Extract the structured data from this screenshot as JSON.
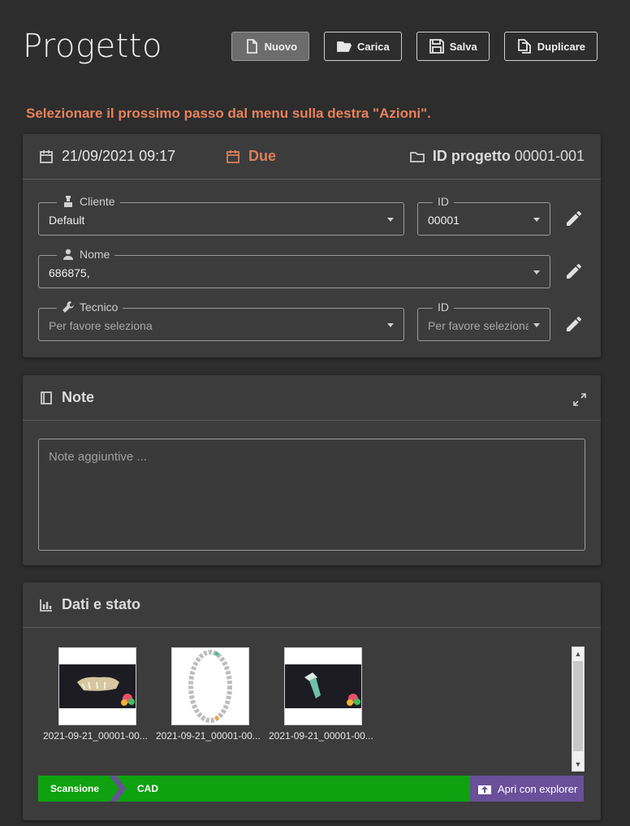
{
  "page": {
    "title": "Progetto"
  },
  "toolbar": {
    "new": "Nuovo",
    "load": "Carica",
    "save": "Salva",
    "duplicate": "Duplicare"
  },
  "hint": "Selezionare il prossimo passo dal menu sulla destra \"Azioni\".",
  "project": {
    "date": "21/09/2021 09:17",
    "due_label": "Due",
    "id_label": "ID progetto",
    "id_value": "00001-001",
    "cliente": {
      "label": "Cliente",
      "value": "Default"
    },
    "cliente_id": {
      "label": "ID",
      "value": "00001"
    },
    "nome": {
      "label": "Nome",
      "value": "686875,"
    },
    "tecnico": {
      "label": "Tecnico",
      "placeholder": "Per favore seleziona"
    },
    "tecnico_id": {
      "label": "ID",
      "placeholder": "Per favore seleziona"
    }
  },
  "notes": {
    "title": "Note",
    "placeholder": "Note aggiuntive ..."
  },
  "data": {
    "title": "Dati e stato",
    "files": [
      {
        "label": "2021-09-21_00001-00..."
      },
      {
        "label": "2021-09-21_00001-00..."
      },
      {
        "label": "2021-09-21_00001-00..."
      }
    ],
    "pipeline": [
      "Scansione",
      "CAD"
    ],
    "explorer_button": "Apri con explorer"
  },
  "colors": {
    "accent": "#e8825a",
    "pipeline": "#0fa10f",
    "explorer": "#6a4f9a"
  }
}
